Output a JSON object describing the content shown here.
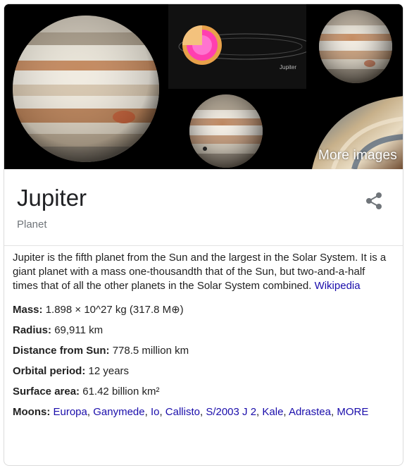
{
  "gallery": {
    "more_images_label": "More images",
    "thumb3_caption": "Jupiter"
  },
  "entity": {
    "title": "Jupiter",
    "subtitle": "Planet"
  },
  "description": {
    "text": "Jupiter is the fifth planet from the Sun and the largest in the Solar System. It is a giant planet with a mass one-thousandth that of the Sun, but two-and-a-half times that of all the other planets in the Solar System combined.",
    "source_link": "Wikipedia"
  },
  "facts": {
    "mass": {
      "label": "Mass:",
      "value": "1.898 × 10^27 kg (317.8 M⊕)"
    },
    "radius": {
      "label": "Radius:",
      "value": "69,911 km"
    },
    "distance": {
      "label": "Distance from Sun:",
      "value": "778.5 million km"
    },
    "orbital_period": {
      "label": "Orbital period:",
      "value": "12 years"
    },
    "surface_area": {
      "label": "Surface area:",
      "value": "61.42 billion km²"
    },
    "moons": {
      "label": "Moons:",
      "items": [
        "Europa",
        "Ganymede",
        "Io",
        "Callisto",
        "S/2003 J 2",
        "Kale",
        "Adrastea"
      ],
      "more_label": "MORE"
    }
  },
  "icons": {
    "share": "share-icon"
  },
  "colors": {
    "link": "#1a0dab",
    "subtitle": "#70757a",
    "border": "#dcdcdc"
  }
}
